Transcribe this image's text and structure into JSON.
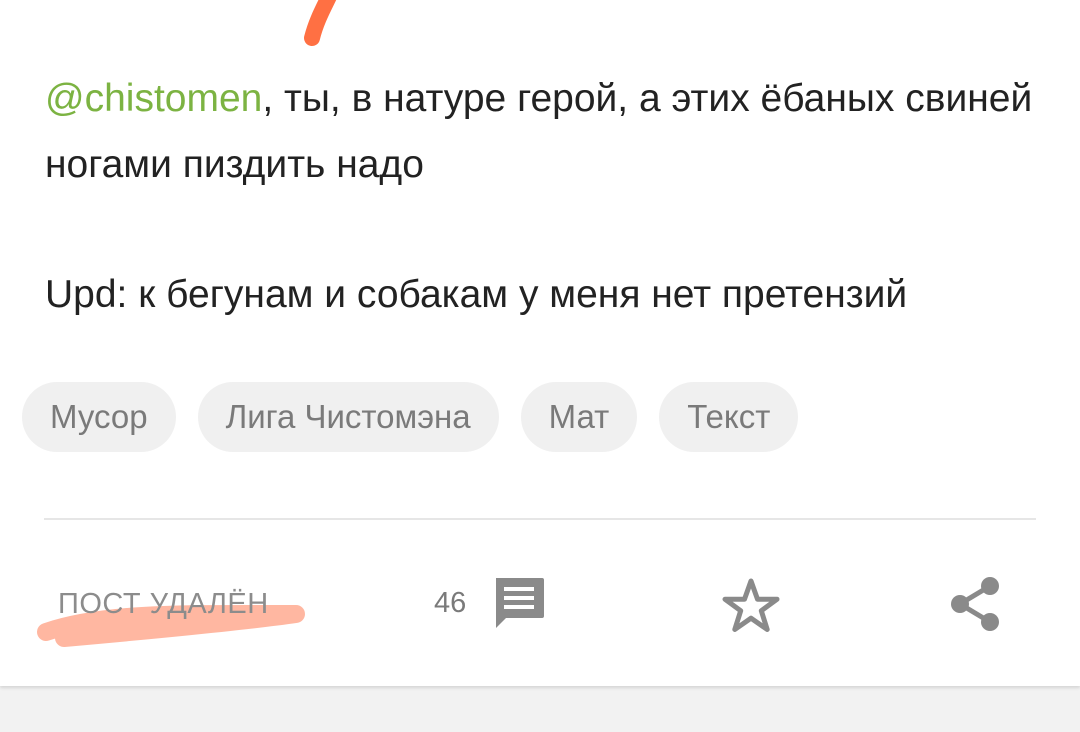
{
  "post": {
    "mention": "@chistomen",
    "line1_rest": ", ты, в натуре герой, а этих ёбаных свиней ногами пиздить надо",
    "update": "Upd: к бегунам и собакам у меня нет претензий"
  },
  "tags": [
    "Мусор",
    "Лига Чистомэна",
    "Мат",
    "Текст"
  ],
  "footer": {
    "status": "ПОСТ УДАЛЁН",
    "comments_count": "46",
    "icons": {
      "comments": "comment-icon",
      "save": "star-icon",
      "share": "share-icon"
    }
  },
  "colors": {
    "mention": "#7cb342",
    "text": "#222222",
    "tag_bg": "#f0f0f0",
    "tag_text": "#7a7a7a",
    "icon": "#8a8a8a",
    "scribble": "#ff7043"
  }
}
